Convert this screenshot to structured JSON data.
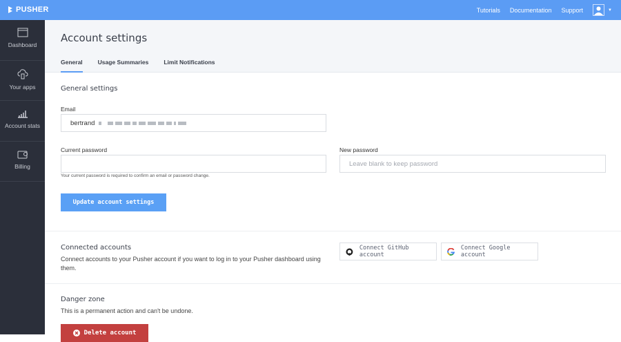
{
  "topbar": {
    "logo": "PUSHER",
    "links": [
      "Tutorials",
      "Documentation",
      "Support"
    ]
  },
  "sidebar": {
    "items": [
      {
        "label": "Dashboard"
      },
      {
        "label": "Your apps"
      },
      {
        "label": "Account stats"
      },
      {
        "label": "Billing"
      }
    ]
  },
  "header": {
    "title": "Account settings",
    "tabs": [
      "General",
      "Usage Summaries",
      "Limit Notifications"
    ]
  },
  "general": {
    "heading": "General settings",
    "email_label": "Email",
    "email_value": "bertrand",
    "current_password_label": "Current password",
    "current_password_value": "",
    "current_password_help": "Your current password is required to confirm an email or password change.",
    "new_password_label": "New password",
    "new_password_placeholder": "Leave blank to keep password",
    "update_button": "Update account settings"
  },
  "connected": {
    "heading": "Connected accounts",
    "description": "Connect accounts to your Pusher account if you want to log in to your Pusher dashboard using them.",
    "github_button": "Connect GitHub account",
    "google_button": "Connect Google account"
  },
  "danger": {
    "heading": "Danger zone",
    "description": "This is a permanent action and can't be undone.",
    "delete_button": "Delete account"
  },
  "colors": {
    "brand": "#5b9cf4",
    "sidebar": "#2b2f3a",
    "danger": "#c3403f"
  }
}
